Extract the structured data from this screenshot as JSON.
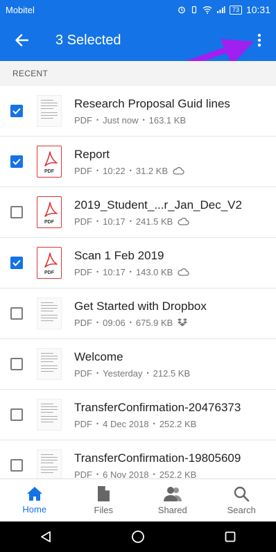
{
  "status_bar": {
    "carrier": "Mobitel",
    "battery": "73",
    "time": "10:31"
  },
  "app_bar": {
    "title": "3 Selected"
  },
  "section_label": "RECENT",
  "files": [
    {
      "name": "Research Proposal Guid lines",
      "type": "PDF",
      "time": "Just now",
      "size": "163.1 KB",
      "checked": true,
      "thumb": "doc",
      "cloud": "none"
    },
    {
      "name": "Report",
      "type": "PDF",
      "time": "10:22",
      "size": "31.2 KB",
      "checked": true,
      "thumb": "pdf",
      "cloud": "cloud"
    },
    {
      "name": "2019_Student_...r_Jan_Dec_V2",
      "type": "PDF",
      "time": "10:17",
      "size": "241.5 KB",
      "checked": false,
      "thumb": "pdf",
      "cloud": "cloud"
    },
    {
      "name": "Scan 1 Feb 2019",
      "type": "PDF",
      "time": "10:17",
      "size": "143.0 KB",
      "checked": true,
      "thumb": "pdf",
      "cloud": "cloud"
    },
    {
      "name": "Get Started with Dropbox",
      "type": "PDF",
      "time": "09:06",
      "size": "675.9 KB",
      "checked": false,
      "thumb": "doc",
      "cloud": "dropbox"
    },
    {
      "name": "Welcome",
      "type": "PDF",
      "time": "Yesterday",
      "size": "212.5 KB",
      "checked": false,
      "thumb": "doc",
      "cloud": "none"
    },
    {
      "name": "TransferConfirmation-20476373",
      "type": "PDF",
      "time": "4 Dec 2018",
      "size": "252.2 KB",
      "checked": false,
      "thumb": "doc",
      "cloud": "none"
    },
    {
      "name": "TransferConfirmation-19805609",
      "type": "PDF",
      "time": "6 Nov 2018",
      "size": "252.2 KB",
      "checked": false,
      "thumb": "doc",
      "cloud": "none"
    }
  ],
  "pdf_badge": "PDF",
  "bottom_nav": [
    {
      "label": "Home",
      "icon": "home-icon",
      "active": true
    },
    {
      "label": "Files",
      "icon": "file-icon",
      "active": false
    },
    {
      "label": "Shared",
      "icon": "people-icon",
      "active": false
    },
    {
      "label": "Search",
      "icon": "search-icon",
      "active": false
    }
  ],
  "colors": {
    "accent": "#1473e6",
    "pdf_red": "#d33",
    "annotation_arrow": "#a020f0"
  }
}
